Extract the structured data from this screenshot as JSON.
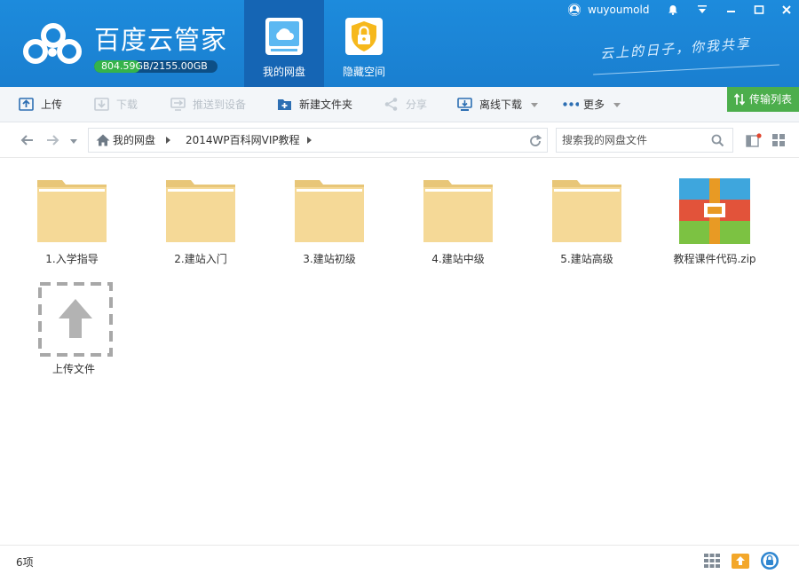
{
  "header": {
    "brand": "百度云管家",
    "quota": {
      "used": "804.59",
      "rest": "GB/2155.00GB",
      "used_fraction": 0.373
    },
    "nav_tabs": [
      {
        "label": "我的网盘",
        "active": true
      },
      {
        "label": "隐藏空间",
        "active": false
      }
    ],
    "slogan": "云上的日子，你我共享",
    "username": "wuyoumold"
  },
  "toolbar": {
    "upload": "上传",
    "download": "下载",
    "push_to_device": "推送到设备",
    "new_folder": "新建文件夹",
    "share": "分享",
    "offline_download": "离线下载",
    "more": "更多",
    "transfer_list": "传输列表"
  },
  "address": {
    "crumbs": [
      "我的网盘",
      "2014WP百科网VIP教程"
    ],
    "search_placeholder": "搜索我的网盘文件"
  },
  "files": [
    {
      "name": "1.入学指导",
      "type": "folder"
    },
    {
      "name": "2.建站入门",
      "type": "folder"
    },
    {
      "name": "3.建站初级",
      "type": "folder"
    },
    {
      "name": "4.建站中级",
      "type": "folder"
    },
    {
      "name": "5.建站高级",
      "type": "folder"
    },
    {
      "name": "教程课件代码.zip",
      "type": "zip"
    }
  ],
  "upload_tile": {
    "label": "上传文件"
  },
  "status": {
    "count": "6项"
  },
  "colors": {
    "header_blue": "#1a84d6",
    "accent_green": "#4cae4c",
    "folder": "#f5d997"
  }
}
